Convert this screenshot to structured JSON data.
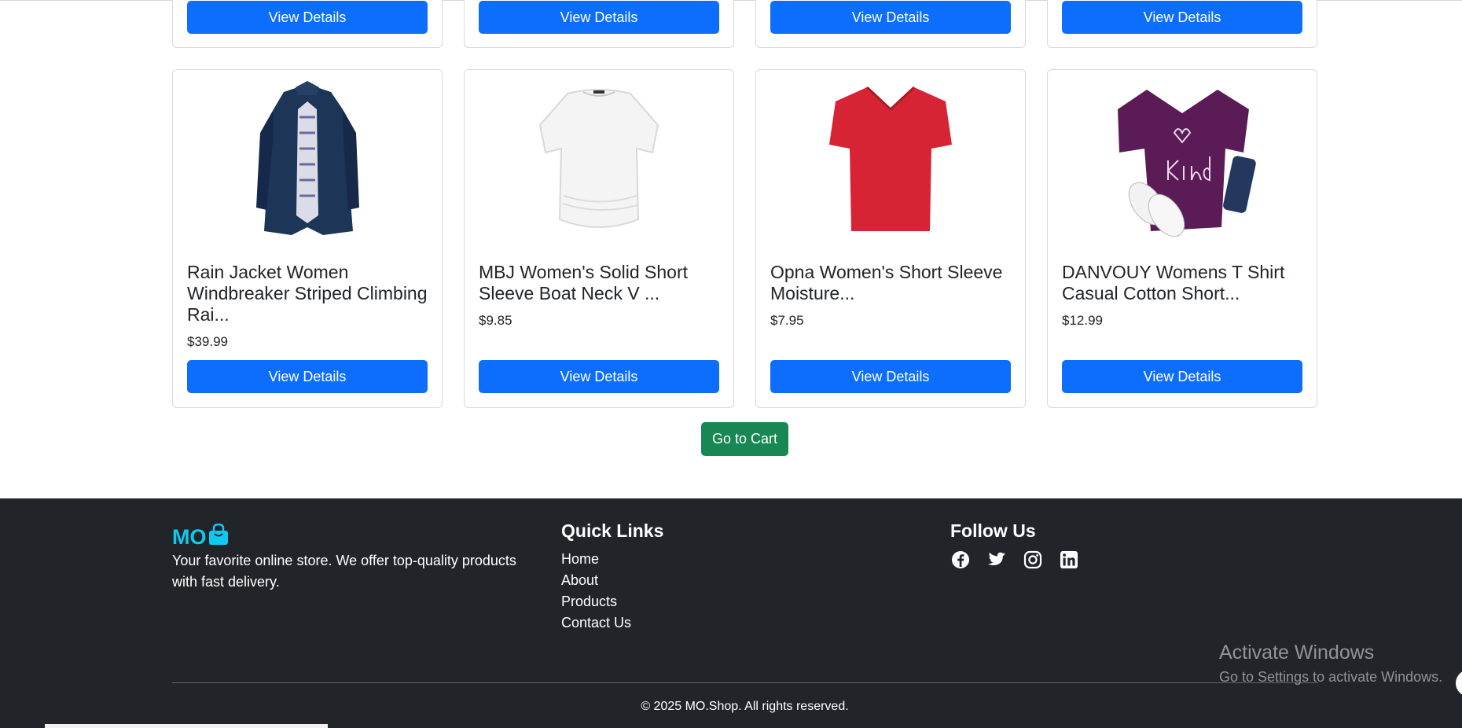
{
  "products_top": [
    {
      "button": "View Details"
    },
    {
      "button": "View Details"
    },
    {
      "button": "View Details"
    },
    {
      "button": "View Details"
    }
  ],
  "products": [
    {
      "title": "Rain Jacket Women Windbreaker Striped Climbing Rai...",
      "price": "$39.99",
      "button": "View Details",
      "image": "navy-rain-jacket"
    },
    {
      "title": "MBJ Women's Solid Short Sleeve Boat Neck V ...",
      "price": "$9.85",
      "button": "View Details",
      "image": "white-boat-neck-tee"
    },
    {
      "title": "Opna Women's Short Sleeve Moisture...",
      "price": "$7.95",
      "button": "View Details",
      "image": "red-v-neck-tee"
    },
    {
      "title": "DANVOUY Womens T Shirt Casual Cotton Short...",
      "price": "$12.99",
      "button": "View Details",
      "image": "purple-be-kind-tee"
    }
  ],
  "cart": {
    "label": "Go to Cart"
  },
  "footer": {
    "brand": "MO",
    "brand_icon": "shopping-bag-icon",
    "about": "Your favorite online store. We offer top-quality products with fast delivery.",
    "quick_links_heading": "Quick Links",
    "quick_links": [
      "Home",
      "About",
      "Products",
      "Contact Us"
    ],
    "follow_heading": "Follow Us",
    "social_icons": [
      "facebook-icon",
      "twitter-icon",
      "instagram-icon",
      "linkedin-icon"
    ],
    "copyright": "© 2025 MO.Shop. All rights reserved."
  },
  "watermark": {
    "line1": "Activate Windows",
    "line2": "Go to Settings to activate Windows."
  },
  "colors": {
    "primary": "#0d6efd",
    "success": "#198754",
    "footer_bg": "#212529",
    "brand": "#0dcaf0"
  }
}
